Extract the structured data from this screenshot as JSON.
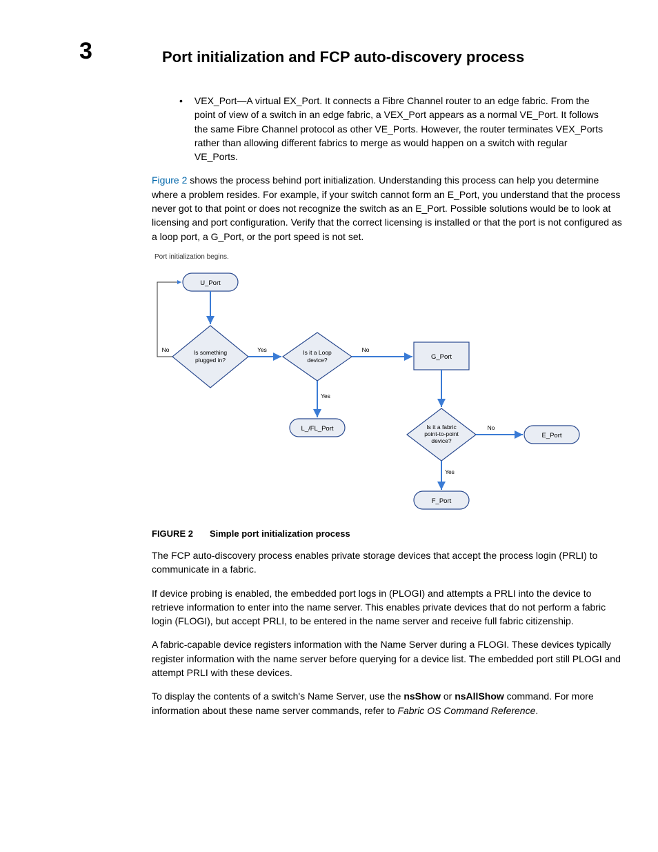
{
  "chapter_number": "3",
  "title": "Port initialization and FCP auto-discovery process",
  "bullet": {
    "lead": "VEX_Port—",
    "text": "A virtual EX_Port. It connects a Fibre Channel router to an edge fabric. From the point of view of a switch in an edge fabric, a VEX_Port appears as a normal VE_Port. It follows the same Fibre Channel protocol as other VE_Ports. However, the router terminates VEX_Ports rather than allowing different fabrics to merge as would happen on a switch with regular VE_Ports."
  },
  "intro_ref": "Figure 2",
  "intro_text": " shows the process behind port initialization. Understanding this process can help you determine where a problem resides. For example, if your switch cannot form an E_Port, you understand that the process never got to that point or does not recognize the switch as an E_Port. Possible solutions would be to look at licensing and port configuration. Verify that the correct licensing is installed or that the port is not configured as a loop port, a G_Port, or the port speed is not set.",
  "flow": {
    "intro": "Port initialization begins.",
    "u_port": "U_Port",
    "q1a": "Is something",
    "q1b": "plugged in?",
    "q2a": "Is it a Loop",
    "q2b": "device?",
    "lfl": "L_/FL_Port",
    "gport": "G_Port",
    "q3a": "Is it a fabric",
    "q3b": "point-to-point",
    "q3c": "device?",
    "eport": "E_Port",
    "fport": "F_Port",
    "yes": "Yes",
    "no": "No"
  },
  "figure": {
    "num": "FIGURE 2",
    "caption": "Simple port initialization process"
  },
  "p1": "The FCP auto-discovery process enables private storage devices that accept the process login (PRLI) to communicate in a fabric.",
  "p2": "If device probing is enabled, the embedded port logs in (PLOGI) and attempts a PRLI into the device to retrieve information to enter into the name server. This enables private devices that do not perform a fabric login (FLOGI), but accept PRLI, to be entered in the name server and receive full fabric citizenship.",
  "p3": "A fabric-capable device registers information with the Name Server during a FLOGI. These devices typically register information with the name server before querying for a device list. The embedded port still PLOGI and attempt PRLI with these devices.",
  "p4a": "To display the contents of a switch's Name Server, use the ",
  "p4_cmd1": "nsShow",
  "p4b": " or ",
  "p4_cmd2": "nsAllShow",
  "p4c": " command. For more information about these name server commands, refer to ",
  "p4_ref": "Fabric OS Command Reference",
  "p4d": "."
}
